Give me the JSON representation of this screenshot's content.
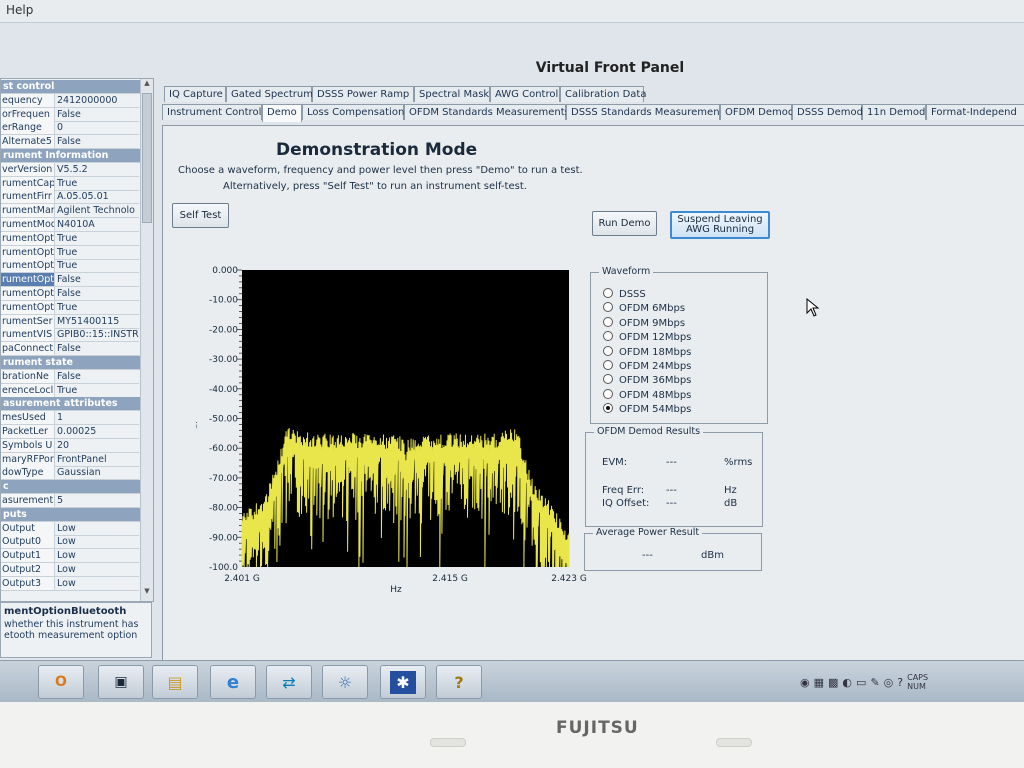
{
  "menubar": {
    "help": "Help"
  },
  "app_title": "Virtual Front Panel",
  "property_grid": {
    "rows": [
      {
        "type": "cat",
        "key": "st control"
      },
      {
        "key": "equency",
        "value": "2412000000"
      },
      {
        "key": "orFrequen",
        "value": "False"
      },
      {
        "key": "erRange",
        "value": "0"
      },
      {
        "key": "Alternate5",
        "value": "False"
      },
      {
        "type": "cat",
        "key": "rument Information"
      },
      {
        "key": "verVersion",
        "value": "V5.5.2"
      },
      {
        "key": "rumentCap",
        "value": "True"
      },
      {
        "key": "rumentFirr",
        "value": "A.05.05.01"
      },
      {
        "key": "rumentMar",
        "value": "Agilent Technolo"
      },
      {
        "key": "rumentMod",
        "value": "N4010A"
      },
      {
        "key": "rumentOpt",
        "value": "True"
      },
      {
        "key": "rumentOpt",
        "value": "True"
      },
      {
        "key": "rumentOpt",
        "value": "True"
      },
      {
        "key": "rumentOpt",
        "value": "False",
        "selected": true
      },
      {
        "key": "rumentOpt",
        "value": "False"
      },
      {
        "key": "rumentOpt",
        "value": "True"
      },
      {
        "key": "rumentSer",
        "value": "MY51400115"
      },
      {
        "key": "rumentVIS",
        "value": "GPIB0::15::INSTR"
      },
      {
        "key": "paConnect",
        "value": "False"
      },
      {
        "type": "cat",
        "key": "rument state"
      },
      {
        "key": "brationNe",
        "value": "False"
      },
      {
        "key": "erenceLocl",
        "value": "True"
      },
      {
        "type": "cat",
        "key": "asurement attributes"
      },
      {
        "key": "mesUsed",
        "value": "1"
      },
      {
        "key": "PacketLer",
        "value": "0.00025"
      },
      {
        "key": "Symbols U",
        "value": "20"
      },
      {
        "key": "maryRFPor",
        "value": "FrontPanel"
      },
      {
        "key": "dowType",
        "value": "Gaussian"
      },
      {
        "type": "cat",
        "key": "c"
      },
      {
        "key": "asurement",
        "value": "5"
      },
      {
        "type": "cat",
        "key": "puts"
      },
      {
        "key": "Output",
        "value": "Low"
      },
      {
        "key": "Output0",
        "value": "Low"
      },
      {
        "key": "Output1",
        "value": "Low"
      },
      {
        "key": "Output2",
        "value": "Low"
      },
      {
        "key": "Output3",
        "value": "Low"
      }
    ],
    "description_title": "mentOptionBluetooth",
    "description_text": "whether this instrument has etooth measurement option"
  },
  "tabs_row1": [
    "IQ Capture",
    "Gated Spectrum",
    "DSSS Power Ramp",
    "Spectral Mask",
    "AWG Control",
    "Calibration Data"
  ],
  "tabs_row2": [
    "Instrument Control",
    "Demo",
    "Loss Compensation",
    "OFDM Standards Measurements",
    "DSSS Standards Measurements",
    "OFDM Demod",
    "DSSS Demod",
    "11n Demod",
    "Format-Independ"
  ],
  "active_tab": "Demo",
  "demo": {
    "title": "Demonstration Mode",
    "instruction1": "Choose a waveform, frequency and power level then press \"Demo\" to run a test.",
    "instruction2": "Alternatively, press \"Self Test\" to run an instrument self-test.",
    "self_test": "Self Test",
    "run_demo": "Run Demo",
    "suspend_line1": "Suspend Leaving",
    "suspend_line2": "AWG Running"
  },
  "waveform": {
    "label": "Waveform",
    "options": [
      "DSSS",
      "OFDM 6Mbps",
      "OFDM 9Mbps",
      "OFDM 12Mbps",
      "OFDM 18Mbps",
      "OFDM 24Mbps",
      "OFDM 36Mbps",
      "OFDM 48Mbps",
      "OFDM 54Mbps"
    ],
    "selected": "OFDM 54Mbps"
  },
  "ofdm_results": {
    "label": "OFDM Demod Results",
    "evm_label": "EVM:",
    "evm_value": "---",
    "evm_unit": "%rms",
    "freq_label": "Freq Err:",
    "freq_value": "---",
    "freq_unit": "Hz",
    "iq_label": "IQ Offset:",
    "iq_value": "---",
    "iq_unit": "dB"
  },
  "avg_power": {
    "label": "Average Power Result",
    "value": "---",
    "unit": "dBm"
  },
  "chart_data": {
    "type": "line",
    "ylabel": "dBm",
    "xlabel": "Hz",
    "ylim": [
      -100,
      0
    ],
    "y_ticks": [
      "0.000",
      "-10.00",
      "-20.00",
      "-30.00",
      "-40.00",
      "-50.00",
      "-60.00",
      "-70.00",
      "-80.00",
      "-90.00",
      "-100.0"
    ],
    "x_ticks": [
      "2.401 G",
      "2.415 G",
      "2.423 G"
    ],
    "xlim_ghz": [
      2.401,
      2.423
    ],
    "grid": false,
    "background_color": "#000000",
    "trace_color": "#e8e64a",
    "series": [
      {
        "x_ghz": [
          2.401,
          2.4025,
          2.403,
          2.4035,
          2.404,
          2.406,
          2.408,
          2.41,
          2.4118,
          2.412,
          2.4122,
          2.414,
          2.416,
          2.418,
          2.4195,
          2.42,
          2.4205,
          2.422,
          2.423
        ],
        "y_dbm": [
          -82,
          -76,
          -70,
          -62,
          -53,
          -55,
          -55,
          -55,
          -56,
          -60,
          -56,
          -55,
          -55,
          -55,
          -53,
          -62,
          -70,
          -80,
          -88
        ]
      }
    ]
  },
  "taskbar": {
    "tray_text": "CAPS NUM"
  },
  "bezel": {
    "brand": "FUJITSU"
  },
  "colors": {
    "panel_bg": "#e9edf0",
    "accent": "#3c8ad6",
    "category": "#8ea3bd"
  }
}
